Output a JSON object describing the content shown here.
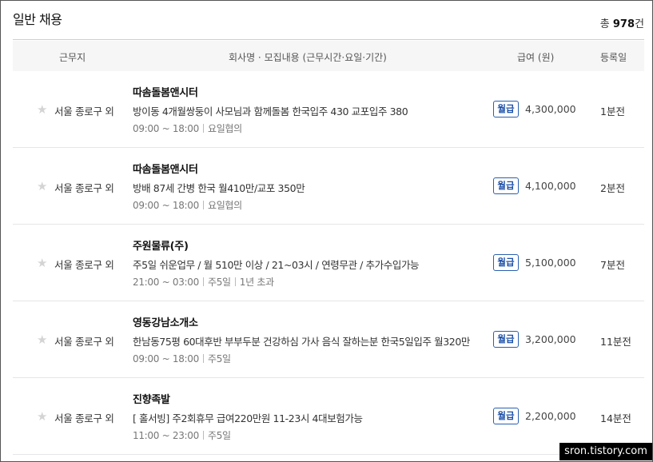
{
  "section": {
    "title": "일반 채용",
    "total_prefix": "총",
    "total_count": "978",
    "total_suffix": "건"
  },
  "columns": {
    "location": "근무지",
    "details": "회사명 · 모집내용 (근무시간·요일·기간)",
    "salary": "급여 (원)",
    "date": "등록일"
  },
  "listings": [
    {
      "location": "서울 종로구 외",
      "company": "따솜돌봄앤시터",
      "description": "방이동 4개월쌍둥이 사모님과 함께돌봄 한국입주 430 교포입주 380",
      "meta": [
        "09:00 ~ 18:00",
        "요일협의"
      ],
      "pay_type": "월급",
      "salary": "4,300,000",
      "posted": "1분전"
    },
    {
      "location": "서울 종로구 외",
      "company": "따솜돌봄앤시터",
      "description": "방배 87세 간병 한국 월410만/교포 350만",
      "meta": [
        "09:00 ~ 18:00",
        "요일협의"
      ],
      "pay_type": "월급",
      "salary": "4,100,000",
      "posted": "2분전"
    },
    {
      "location": "서울 종로구 외",
      "company": "주원물류(주)",
      "description": "주5일 쉬운업무 / 월 510만 이상 / 21~03시 / 연령무관 / 추가수입가능",
      "meta": [
        "21:00 ~ 03:00",
        "주5일",
        "1년 초과"
      ],
      "pay_type": "월급",
      "salary": "5,100,000",
      "posted": "7분전"
    },
    {
      "location": "서울 종로구 외",
      "company": "영동강남소개소",
      "description": "한남동75평 60대후반 부부두분 건강하심 가사 음식 잘하는분 한국5일입주 월320만",
      "meta": [
        "09:00 ~ 18:00",
        "주5일"
      ],
      "pay_type": "월급",
      "salary": "3,200,000",
      "posted": "11분전"
    },
    {
      "location": "서울 종로구 외",
      "company": "진향족발",
      "description": "[ 홀서빙] 주2회휴무 급여220만원 11-23시 4대보험가능",
      "meta": [
        "11:00 ~ 23:00",
        "주5일"
      ],
      "pay_type": "월급",
      "salary": "2,200,000",
      "posted": "14분전"
    }
  ],
  "watermark": "sron.tistory.com"
}
